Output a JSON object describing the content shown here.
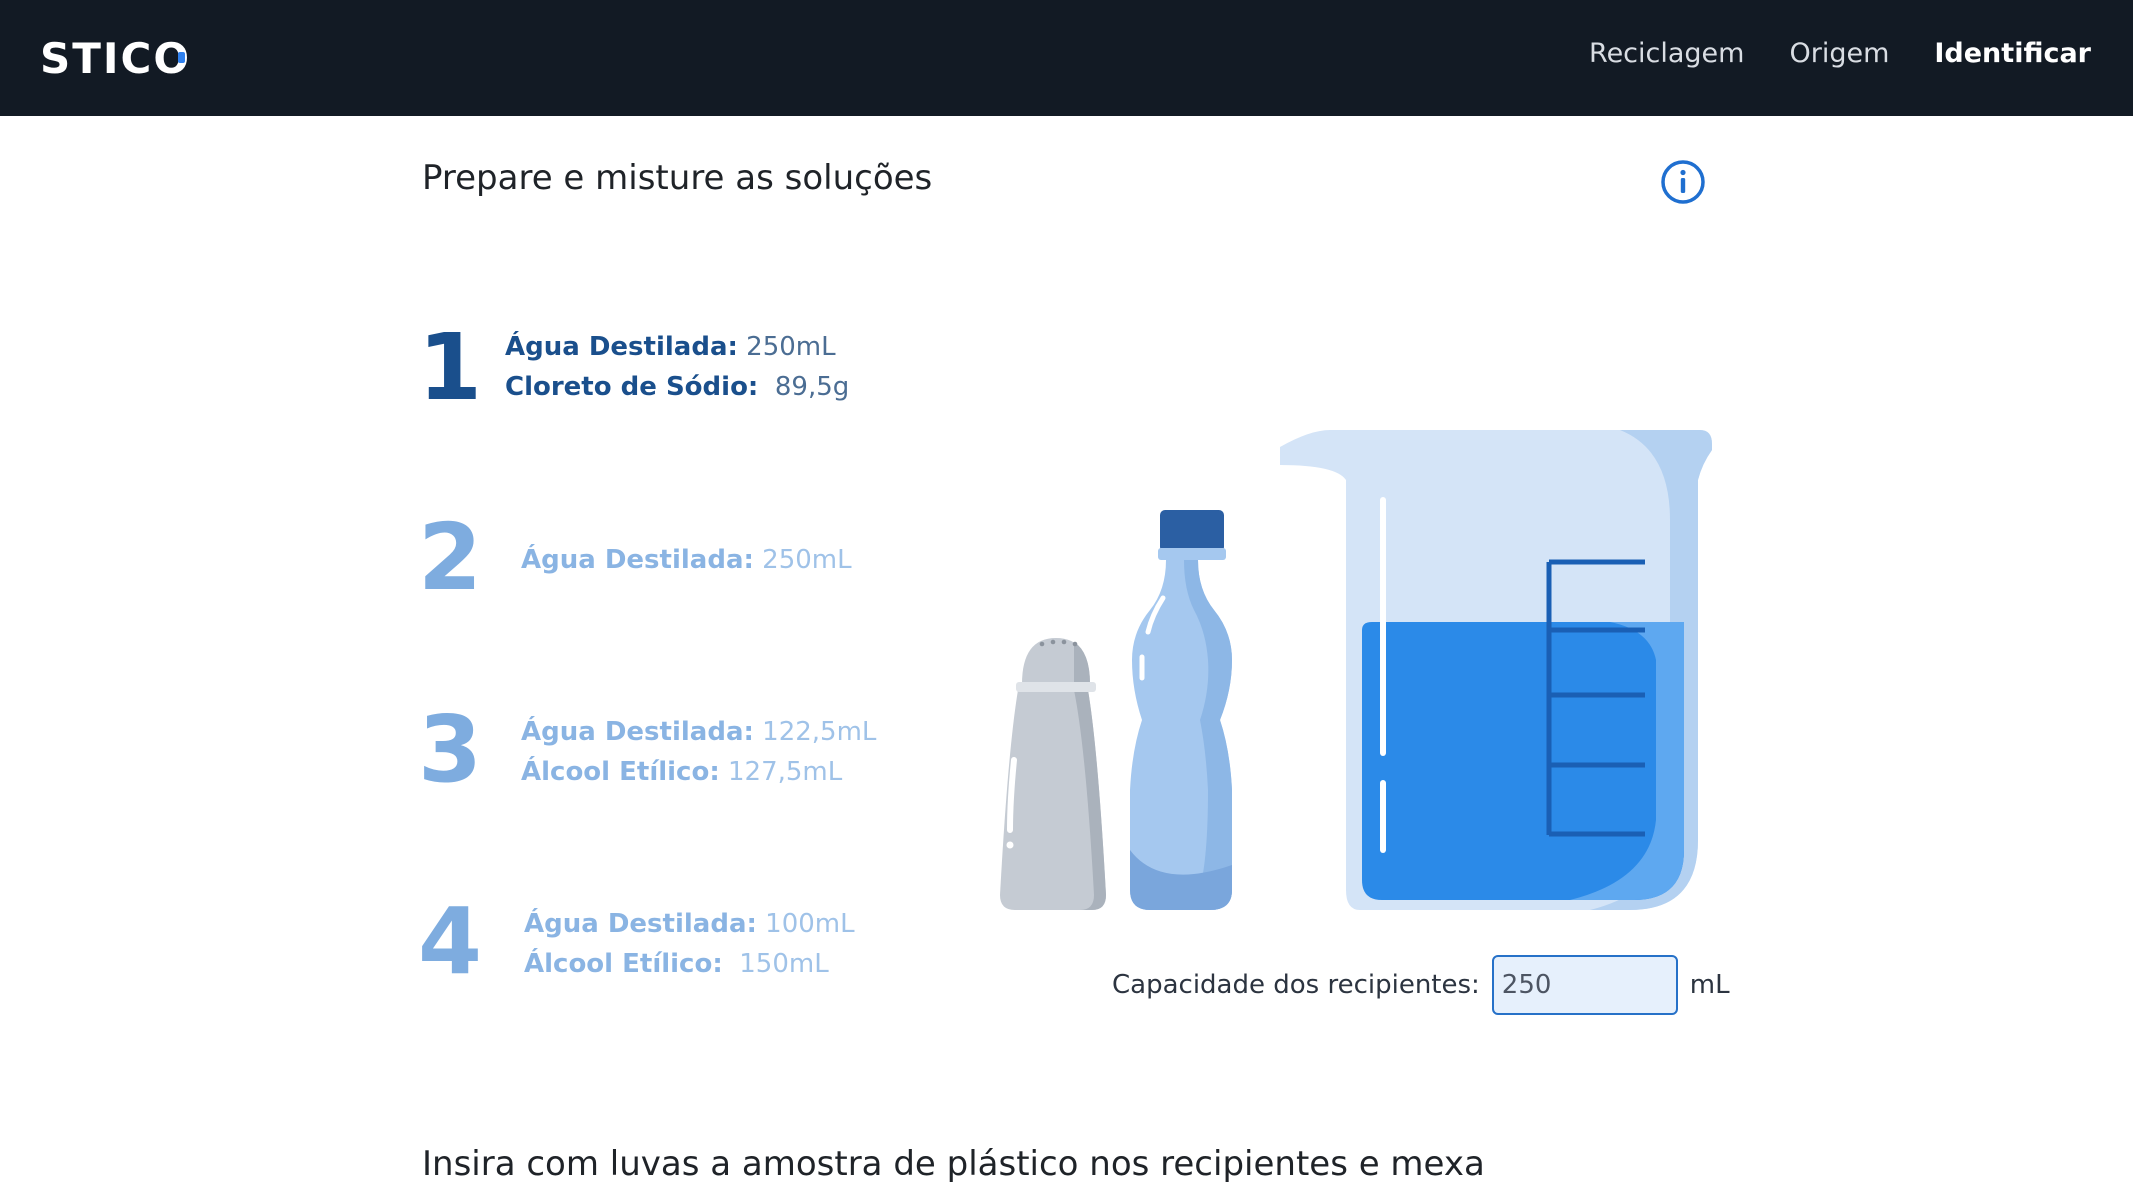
{
  "header": {
    "logo": "STICO",
    "nav": [
      {
        "label": "Reciclagem"
      },
      {
        "label": "Origem"
      },
      {
        "label": "Identificar"
      }
    ]
  },
  "main": {
    "title": "Prepare e misture as soluções",
    "info_icon": "info-circle-icon",
    "steps": [
      {
        "number": "1",
        "lines": [
          {
            "label": "Água Destilada:",
            "value": "250mL"
          },
          {
            "label": "Cloreto de Sódio:",
            "value": "89,5g"
          }
        ]
      },
      {
        "number": "2",
        "lines": [
          {
            "label": "Água Destilada:",
            "value": "250mL"
          }
        ]
      },
      {
        "number": "3",
        "lines": [
          {
            "label": "Água Destilada:",
            "value": "122,5mL"
          },
          {
            "label": "Álcool Etílico:",
            "value": "127,5mL"
          }
        ]
      },
      {
        "number": "4",
        "lines": [
          {
            "label": "Água Destilada:",
            "value": "100mL"
          },
          {
            "label": "Álcool Etílico:",
            "value": "150mL"
          }
        ]
      }
    ],
    "capacity": {
      "label": "Capacidade dos recipientes:",
      "value": "250",
      "unit": "mL"
    },
    "next_step_title": "Insira com luvas a amostra de plástico nos recipientes e mexa"
  },
  "colors": {
    "topbar": "#121a24",
    "accent": "#2671c8",
    "active_step": "#1a4f8c",
    "inactive_step": "#7eacdf"
  }
}
